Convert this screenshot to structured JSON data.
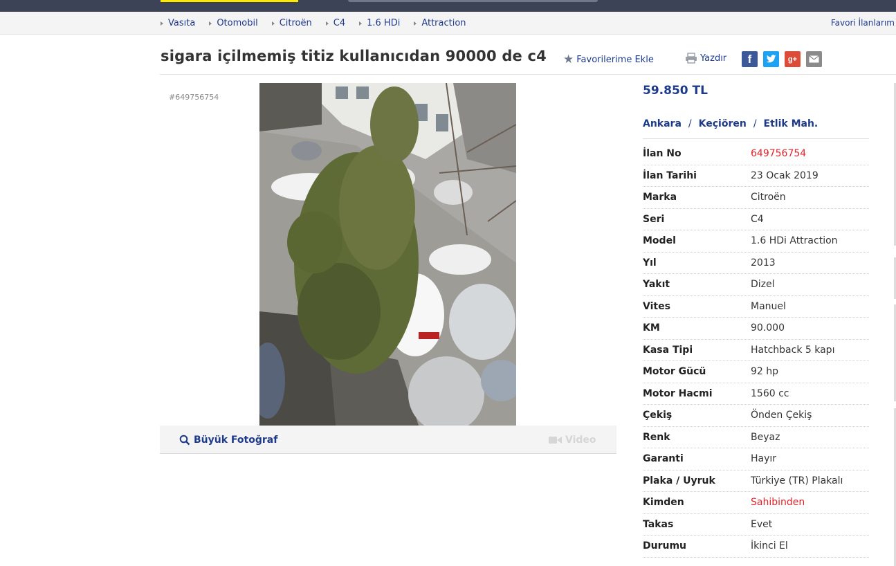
{
  "breadcrumb": {
    "items": [
      "Vasıta",
      "Otomobil",
      "Citroën",
      "C4",
      "1.6 HDi",
      "Attraction"
    ],
    "favorites_link": "Favori İlanlarım"
  },
  "header": {
    "title": "sigara içilmemiş titiz kullanıcıdan 90000 de c4",
    "add_favorite": "Favorilerime Ekle",
    "print": "Yazdır"
  },
  "gallery": {
    "ad_number": "#649756754",
    "big_photo_label": "Büyük Fotoğraf",
    "video_label": "Video"
  },
  "info": {
    "price": "59.850 TL",
    "location": [
      "Ankara",
      "Keçiören",
      "Etlik Mah."
    ],
    "details": [
      {
        "label": "İlan No",
        "value": "649756754",
        "highlight": true
      },
      {
        "label": "İlan Tarihi",
        "value": "23 Ocak 2019"
      },
      {
        "label": "Marka",
        "value": "Citroën"
      },
      {
        "label": "Seri",
        "value": "C4"
      },
      {
        "label": "Model",
        "value": "1.6 HDi Attraction"
      },
      {
        "label": "Yıl",
        "value": "2013"
      },
      {
        "label": "Yakıt",
        "value": "Dizel"
      },
      {
        "label": "Vites",
        "value": "Manuel"
      },
      {
        "label": "KM",
        "value": "90.000"
      },
      {
        "label": "Kasa Tipi",
        "value": "Hatchback 5 kapı"
      },
      {
        "label": "Motor Gücü",
        "value": "92 hp"
      },
      {
        "label": "Motor Hacmi",
        "value": "1560 cc"
      },
      {
        "label": "Çekiş",
        "value": "Önden Çekiş"
      },
      {
        "label": "Renk",
        "value": "Beyaz"
      },
      {
        "label": "Garanti",
        "value": "Hayır"
      },
      {
        "label": "Plaka / Uyruk",
        "value": "Türkiye (TR) Plakalı"
      },
      {
        "label": "Kimden",
        "value": "Sahibinden",
        "highlight": true
      },
      {
        "label": "Takas",
        "value": "Evet"
      },
      {
        "label": "Durumu",
        "value": "İkinci El"
      }
    ]
  },
  "colors": {
    "link_blue": "#1e3a8a",
    "highlight_red": "#e3222b",
    "topbar": "#3d4357",
    "brand_yellow": "#ffe800"
  }
}
